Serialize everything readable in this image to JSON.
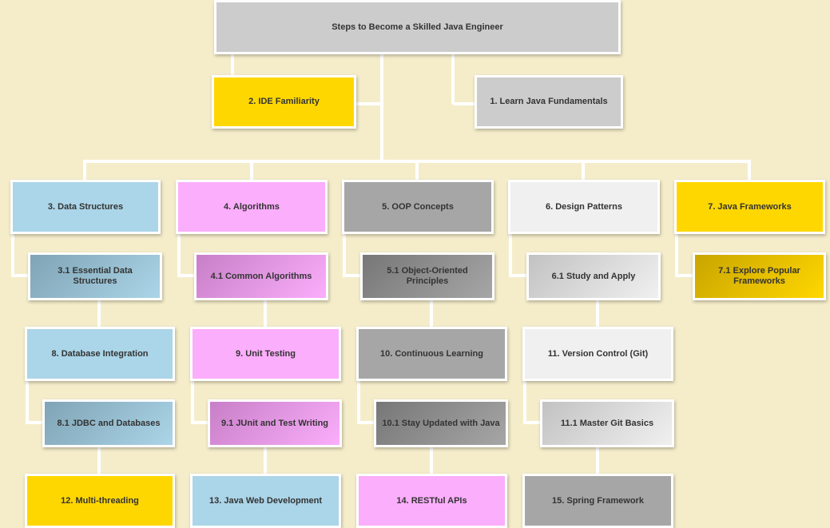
{
  "diagram": {
    "root": "Steps to Become a Skilled Java Engineer",
    "level1": {
      "ide": "2. IDE Familiarity",
      "fundamentals": "1. Learn Java Fundamentals"
    },
    "columns": [
      {
        "top": "3. Data Structures",
        "top_child": "3.1 Essential Data Structures",
        "mid": "8. Database Integration",
        "mid_child": "8.1 JDBC and Databases",
        "bottom": "12. Multi-threading"
      },
      {
        "top": "4. Algorithms",
        "top_child": "4.1 Common Algorithms",
        "mid": "9. Unit Testing",
        "mid_child": "9.1 JUnit and Test Writing",
        "bottom": "13. Java Web Development"
      },
      {
        "top": "5. OOP Concepts",
        "top_child": "5.1 Object-Oriented Principles",
        "mid": "10. Continuous Learning",
        "mid_child": "10.1 Stay Updated with Java",
        "bottom": "14. RESTful APIs"
      },
      {
        "top": "6. Design Patterns",
        "top_child": "6.1 Study and Apply",
        "mid": "11. Version Control (Git)",
        "mid_child": "11.1 Master Git Basics",
        "bottom": "15. Spring Framework"
      },
      {
        "top": "7. Java Frameworks",
        "top_child": "7.1 Explore Popular Frameworks"
      }
    ]
  },
  "colors": {
    "background": "#f5edca",
    "gray": "#cccccc",
    "yellow": "#ffd700",
    "blue": "#abd5e8",
    "pink": "#fbaefb",
    "mid_gray": "#a6a6a6",
    "light_gray": "#f0f0f0",
    "connector": "#ffffff"
  }
}
